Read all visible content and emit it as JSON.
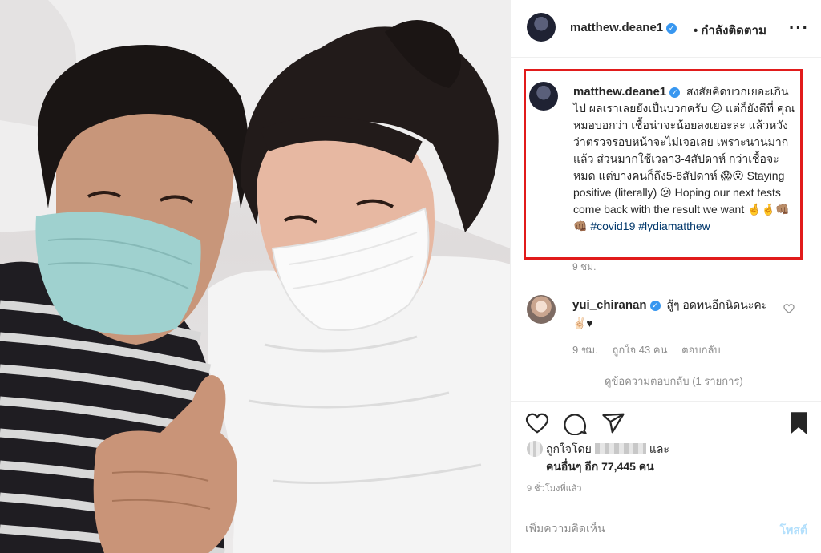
{
  "post": {
    "author": "matthew.deane1",
    "follow_status": "• กำลังติดตาม",
    "more_icon": "more-options-icon",
    "caption_text": "สงสัยคิดบวกเยอะเกินไป ผลเราเลยยังเป็นบวกครับ 😕 แต่ก็ยังดีที่ คุณหมอบอกว่า เชื้อน่าจะน้อยลงเยอะละ แล้วหวังว่าตรวจรอบหน้าจะไม่เจอเลย เพราะนานมากแล้ว ส่วนมากใช้เวลา3-4สัปดาห์ กว่าเชื้อจะหมด แต่บางคนก็ถึง5-6สัปดาห์ 😱😮 Staying positive (literally) 😕 Hoping our next tests come back with the result we want 🤞🤞👊🏽👊🏽",
    "hashtags": "#covid19 #lydiamatthew",
    "caption_time": "9 ชม."
  },
  "comment": {
    "author": "yui_chiranan",
    "text": "สู้ๆ อดทนอีกนิดนะคะ ✌🏻♥",
    "time": "9 ชม.",
    "likes": "ถูกใจ 43 คน",
    "reply": "ตอบกลับ",
    "view_replies": "ดูข้อความตอบกลับ (1 รายการ)"
  },
  "likes": {
    "prefix": "ถูกใจโดย",
    "and": "และ",
    "others": "คนอื่นๆ อีก 77,445 คน"
  },
  "post_time": "9 ชั่วโมงที่แล้ว",
  "add_comment": {
    "placeholder": "เพิ่มความคิดเห็น",
    "post_label": "โพสต์"
  },
  "colors": {
    "highlight_border": "#e11b1b",
    "verified": "#3897f0",
    "hashtag": "#00376b",
    "post_button": "#b2dffc"
  }
}
